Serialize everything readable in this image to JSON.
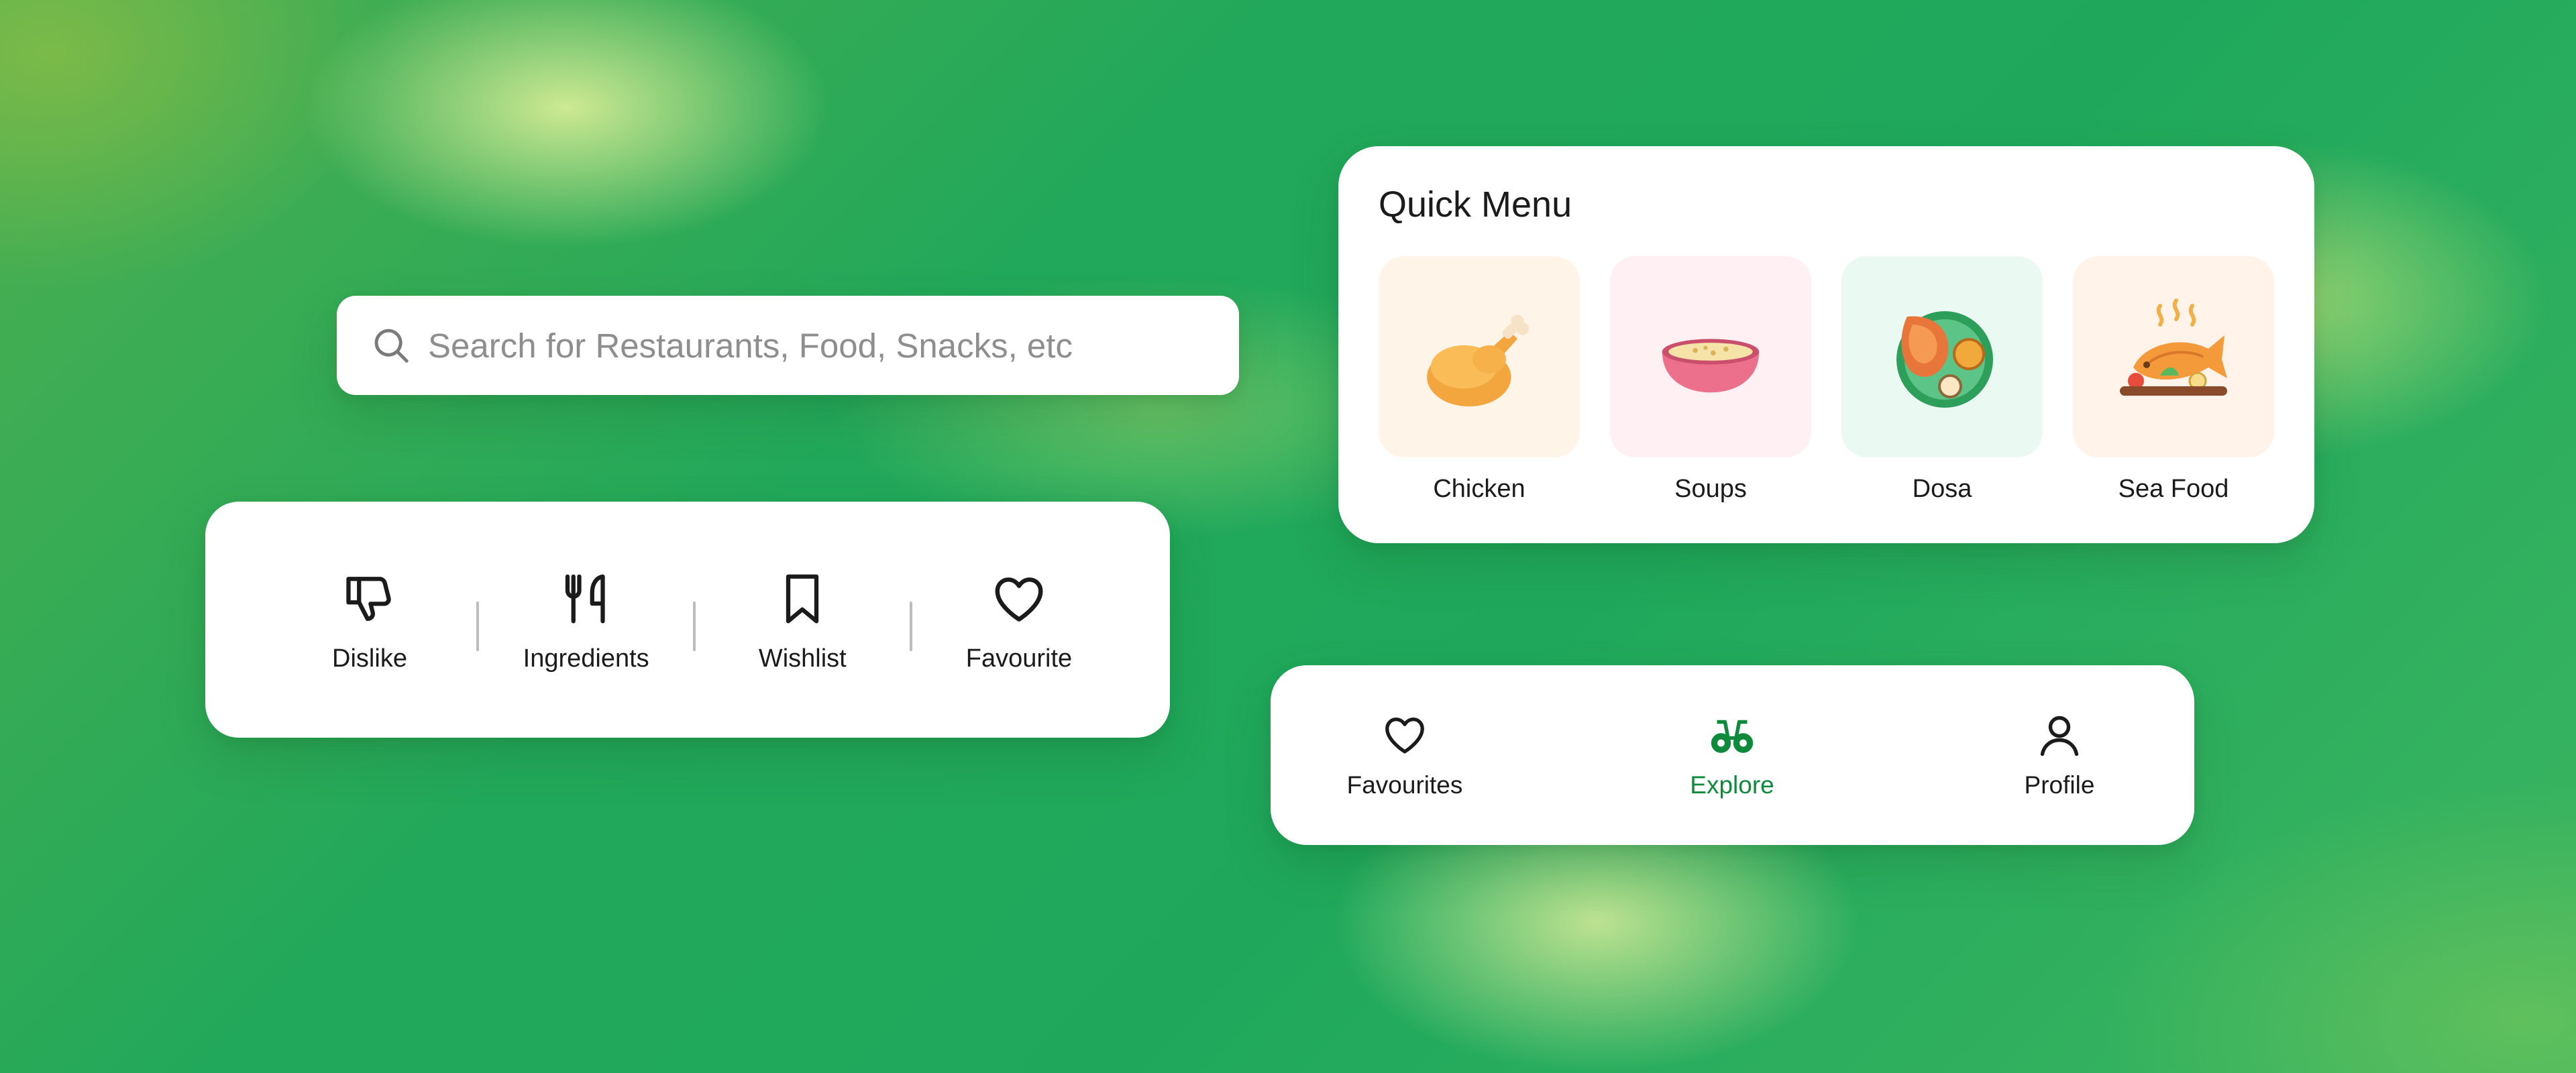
{
  "search": {
    "placeholder": "Search for Restaurants, Food, Snacks, etc",
    "icon": "search-icon"
  },
  "actions": [
    {
      "label": "Dislike",
      "icon": "thumbs-down-icon"
    },
    {
      "label": "Ingredients",
      "icon": "fork-knife-icon"
    },
    {
      "label": "Wishlist",
      "icon": "bookmark-icon"
    },
    {
      "label": "Favourite",
      "icon": "heart-icon"
    }
  ],
  "quick_menu": {
    "title": "Quick Menu",
    "items": [
      {
        "label": "Chicken",
        "icon": "chicken-icon",
        "bg": "#fff4e8"
      },
      {
        "label": "Soups",
        "icon": "soup-bowl-icon",
        "bg": "#fff0f3"
      },
      {
        "label": "Dosa",
        "icon": "dosa-plate-icon",
        "bg": "#eaf9f1"
      },
      {
        "label": "Sea Food",
        "icon": "fish-platter-icon",
        "bg": "#fff3ea"
      }
    ]
  },
  "bottom_nav": {
    "items": [
      {
        "label": "Favourites",
        "icon": "heart-icon",
        "active": false
      },
      {
        "label": "Explore",
        "icon": "binoculars-icon",
        "active": true
      },
      {
        "label": "Profile",
        "icon": "user-icon",
        "active": false
      }
    ]
  },
  "colors": {
    "accent": "#0f8a3c",
    "text": "#1b1b1b",
    "placeholder": "#8e8e8e"
  }
}
